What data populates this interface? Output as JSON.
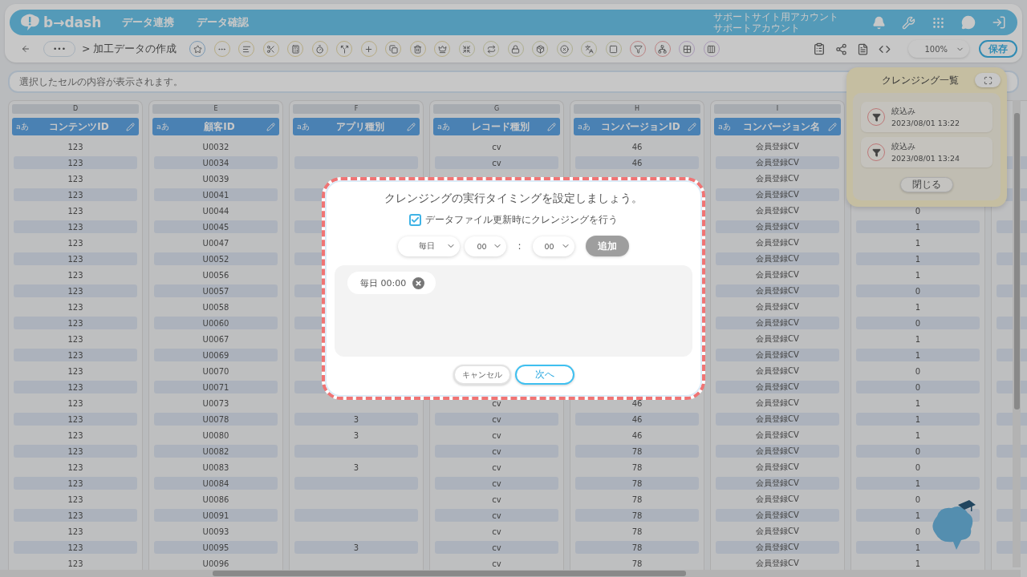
{
  "header": {
    "logo": "b→dash",
    "nav": [
      {
        "label": "データ連携"
      },
      {
        "label": "データ確認"
      }
    ],
    "account": [
      "サポートサイト用アカウント",
      "サポートアカウント"
    ]
  },
  "toolbar": {
    "more": "•••",
    "breadcrumb": "> 加工データの作成",
    "zoom": "100%",
    "save": "保存"
  },
  "formula_bar": {
    "placeholder": "選択したセルの内容が表示されます。"
  },
  "table": {
    "columns": [
      {
        "letter": "D",
        "type_label": "aあ",
        "title": "コンテンツID"
      },
      {
        "letter": "E",
        "type_label": "aあ",
        "title": "顧客ID"
      },
      {
        "letter": "F",
        "type_label": "aあ",
        "title": "アプリ種別"
      },
      {
        "letter": "G",
        "type_label": "aあ",
        "title": "レコード種別"
      },
      {
        "letter": "H",
        "type_label": "aあ",
        "title": "コンバージョンID"
      },
      {
        "letter": "I",
        "type_label": "aあ",
        "title": "コンバージョン名"
      }
    ],
    "rows": [
      [
        "123",
        "U0032",
        null,
        "cv",
        "46",
        "会員登録CV",
        null
      ],
      [
        "123",
        "U0034",
        null,
        "cv",
        "46",
        "会員登録CV",
        null
      ],
      [
        "123",
        "U0039",
        null,
        null,
        null,
        "会員登録CV",
        null
      ],
      [
        "123",
        "U0041",
        null,
        null,
        null,
        "会員登録CV",
        null
      ],
      [
        "123",
        "U0044",
        null,
        null,
        null,
        "会員登録CV",
        "0"
      ],
      [
        "123",
        "U0045",
        null,
        null,
        null,
        "会員登録CV",
        "1"
      ],
      [
        "123",
        "U0047",
        null,
        null,
        null,
        "会員登録CV",
        "1"
      ],
      [
        "123",
        "U0052",
        null,
        null,
        null,
        "会員登録CV",
        "1"
      ],
      [
        "123",
        "U0056",
        null,
        null,
        null,
        "会員登録CV",
        "1"
      ],
      [
        "123",
        "U0057",
        null,
        null,
        null,
        "会員登録CV",
        "0"
      ],
      [
        "123",
        "U0058",
        null,
        null,
        null,
        "会員登録CV",
        "1"
      ],
      [
        "123",
        "U0060",
        null,
        null,
        null,
        "会員登録CV",
        "0"
      ],
      [
        "123",
        "U0067",
        null,
        null,
        null,
        "会員登録CV",
        "1"
      ],
      [
        "123",
        "U0069",
        null,
        null,
        null,
        "会員登録CV",
        "1"
      ],
      [
        "123",
        "U0070",
        null,
        null,
        null,
        "会員登録CV",
        "0"
      ],
      [
        "123",
        "U0071",
        null,
        null,
        null,
        "会員登録CV",
        "0"
      ],
      [
        "123",
        "U0073",
        null,
        "cv",
        "46",
        "会員登録CV",
        "1"
      ],
      [
        "123",
        "U0078",
        "3",
        "cv",
        "46",
        "会員登録CV",
        "1"
      ],
      [
        "123",
        "U0080",
        "3",
        "cv",
        "46",
        "会員登録CV",
        "1"
      ],
      [
        "123",
        "U0082",
        null,
        "cv",
        "78",
        "会員登録CV",
        "0"
      ],
      [
        "123",
        "U0083",
        "3",
        "cv",
        "78",
        "会員登録CV",
        "0"
      ],
      [
        "123",
        "U0084",
        null,
        "cv",
        "78",
        "会員登録CV",
        "1"
      ],
      [
        "123",
        "U0086",
        null,
        "cv",
        "78",
        "会員登録CV",
        "0"
      ],
      [
        "123",
        "U0091",
        null,
        "cv",
        "78",
        "会員登録CV",
        "1"
      ],
      [
        "123",
        "U0093",
        null,
        "cv",
        "78",
        "会員登録CV",
        "0"
      ],
      [
        "123",
        "U0095",
        "3",
        "cv",
        "78",
        "会員登録CV",
        "1"
      ],
      [
        "123",
        "U0096",
        null,
        "cv",
        "78",
        "会員登録CV",
        "1"
      ]
    ]
  },
  "cleansing_panel": {
    "title": "クレンジング一覧",
    "items": [
      {
        "action": "絞込み",
        "time": "2023/08/01 13:22"
      },
      {
        "action": "絞込み",
        "time": "2023/08/01 13:24"
      }
    ],
    "close": "閉じる"
  },
  "dialog": {
    "title": "クレンジングの実行タイミングを設定しましょう。",
    "checkbox": {
      "label": "データファイル更新時にクレンジングを行う",
      "checked": true
    },
    "frequency": "毎日",
    "hour": "00",
    "separator": ":",
    "minute": "00",
    "add_button": {
      "label": "追加",
      "disabled": true
    },
    "schedules": [
      {
        "label": "毎日 00:00"
      }
    ],
    "buttons": [
      {
        "label": "キャンセル",
        "kind": "secondary"
      },
      {
        "label": "次へ",
        "kind": "primary"
      }
    ]
  }
}
